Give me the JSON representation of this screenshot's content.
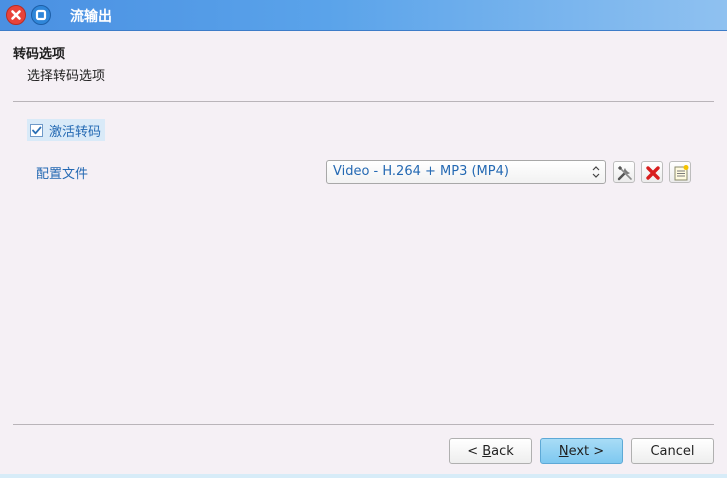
{
  "window": {
    "title": "流输出",
    "controls": [
      "close-icon",
      "maximize-icon"
    ]
  },
  "header": {
    "title": "转码选项",
    "subtitle": "选择转码选项"
  },
  "transcode": {
    "activate_label": "激活转码",
    "activate_checked": true,
    "profile_label": "配置文件",
    "profile_value": "Video - H.264 + MP3 (MP4)",
    "tools": [
      "edit-profile-icon",
      "delete-profile-icon",
      "new-profile-icon"
    ]
  },
  "buttons": {
    "back": {
      "prefix": "< ",
      "mnemonic": "B",
      "rest": "ack"
    },
    "next": {
      "mnemonic": "N",
      "rest": "ext >"
    },
    "cancel": "Cancel"
  },
  "colors": {
    "accent": "#2469b3",
    "titlebar": "#4a90e2",
    "next_button": "#7ec8f0"
  }
}
